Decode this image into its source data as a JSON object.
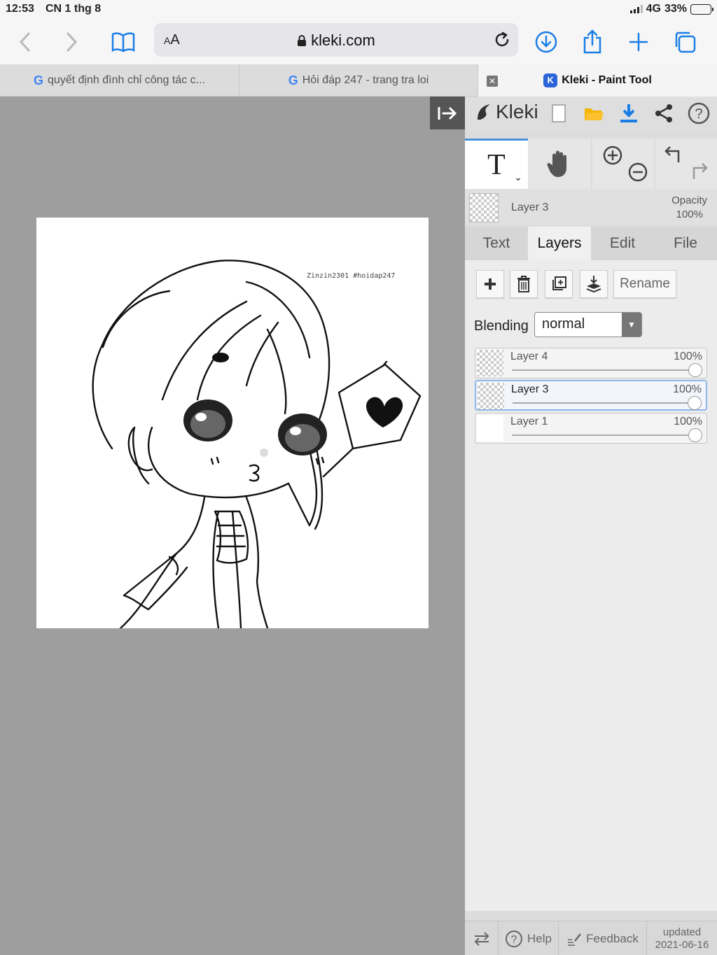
{
  "status": {
    "time": "12:53",
    "date": "CN 1 thg 8",
    "network": "4G",
    "battery": "33%",
    "battery_level": 0.33
  },
  "toolbar": {
    "aa_big": "A",
    "aa_small": "A",
    "url": "kleki.com"
  },
  "tabs": [
    {
      "label": "quyết định đình chỉ công tác c...",
      "icon": "google-g"
    },
    {
      "label": "Hỏi đáp 247 - trang tra loi",
      "icon": "google-g"
    },
    {
      "label": "Kleki - Paint Tool",
      "icon": "kleki-icon",
      "active": true
    }
  ],
  "canvas": {
    "signature": "Zinzin2301 #hoidap247"
  },
  "app": {
    "logo": "Kleki",
    "current_layer": {
      "name": "Layer 3",
      "opacity_label": "Opacity",
      "opacity_value": "100%"
    },
    "menu_tabs": [
      "Text",
      "Layers",
      "Edit",
      "File"
    ],
    "active_menu_tab": "Layers",
    "rename_label": "Rename",
    "blending_label": "Blending",
    "blending_value": "normal",
    "layers": [
      {
        "name": "Layer 4",
        "opacity": "100%",
        "selected": false
      },
      {
        "name": "Layer 3",
        "opacity": "100%",
        "selected": true
      },
      {
        "name": "Layer 1",
        "opacity": "100%",
        "selected": false
      }
    ],
    "footer": {
      "help": "Help",
      "feedback": "Feedback",
      "updated_label": "updated",
      "updated_date": "2021-06-16"
    }
  },
  "colors": {
    "accent_blue": "#1a7ee6",
    "selection_blue": "#8fb6ea",
    "folder_yellow": "#f4b400"
  }
}
